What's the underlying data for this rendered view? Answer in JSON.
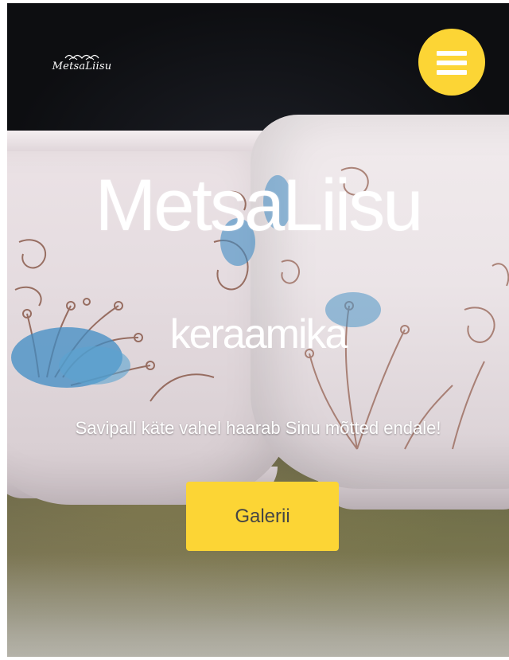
{
  "header": {
    "logo_text": "MetsaLiisu",
    "menu_icon": "hamburger-menu-icon"
  },
  "hero": {
    "title": "MetsaLiisu",
    "subtitle": "keraamika",
    "tagline": "Savipall käte vahel haarab Sinu mõtted endale!",
    "cta_label": "Galerii"
  },
  "colors": {
    "accent": "#fcd535",
    "text_on_hero": "#ffffff",
    "cta_text": "#454545"
  }
}
